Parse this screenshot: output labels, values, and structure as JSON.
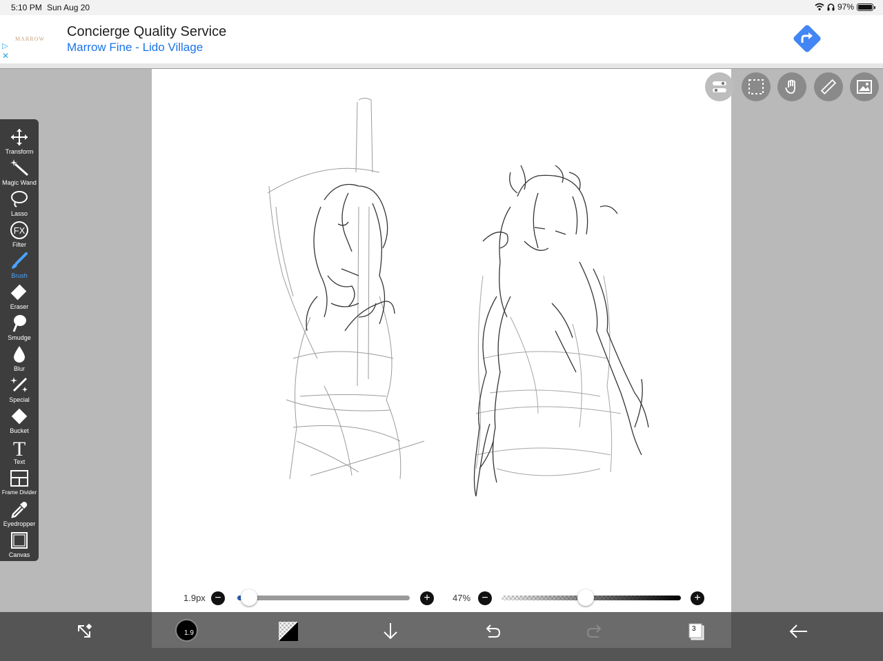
{
  "status_bar": {
    "time": "5:10 PM",
    "date": "Sun Aug 20",
    "battery": "97%"
  },
  "ad": {
    "logo": "MARROW",
    "title": "Concierge Quality Service",
    "subtitle": "Marrow Fine - Lido Village",
    "adchoices_icon": "adchoices-icon",
    "close_icon": "close-icon",
    "action_icon": "directions-icon"
  },
  "top_tools": [
    {
      "name": "toggle-icon"
    },
    {
      "name": "selection-icon"
    },
    {
      "name": "hand-icon"
    },
    {
      "name": "ruler-icon"
    },
    {
      "name": "image-icon"
    }
  ],
  "toolbar": {
    "tools": [
      {
        "label": "Transform",
        "icon": "transform-icon"
      },
      {
        "label": "Magic Wand",
        "icon": "magic-wand-icon"
      },
      {
        "label": "Lasso",
        "icon": "lasso-icon"
      },
      {
        "label": "Filter",
        "icon": "filter-icon"
      },
      {
        "label": "Brush",
        "icon": "brush-icon",
        "active": true
      },
      {
        "label": "Eraser",
        "icon": "eraser-icon"
      },
      {
        "label": "Smudge",
        "icon": "smudge-icon"
      },
      {
        "label": "Blur",
        "icon": "blur-icon"
      },
      {
        "label": "Special",
        "icon": "special-icon"
      },
      {
        "label": "Bucket",
        "icon": "bucket-icon"
      },
      {
        "label": "Text",
        "icon": "text-icon"
      },
      {
        "label": "Frame Divider",
        "icon": "frame-divider-icon"
      },
      {
        "label": "Eyedropper",
        "icon": "eyedropper-icon"
      },
      {
        "label": "Canvas",
        "icon": "canvas-icon"
      }
    ]
  },
  "brush_size": {
    "label": "1.9px",
    "fraction": 0.02
  },
  "opacity": {
    "label": "47%",
    "fraction": 0.47
  },
  "bottom_bar": {
    "brush_size_badge": "1.9",
    "layers_count": "3",
    "colors": {
      "bar": "#555555",
      "center": "#6b6b6b"
    }
  }
}
